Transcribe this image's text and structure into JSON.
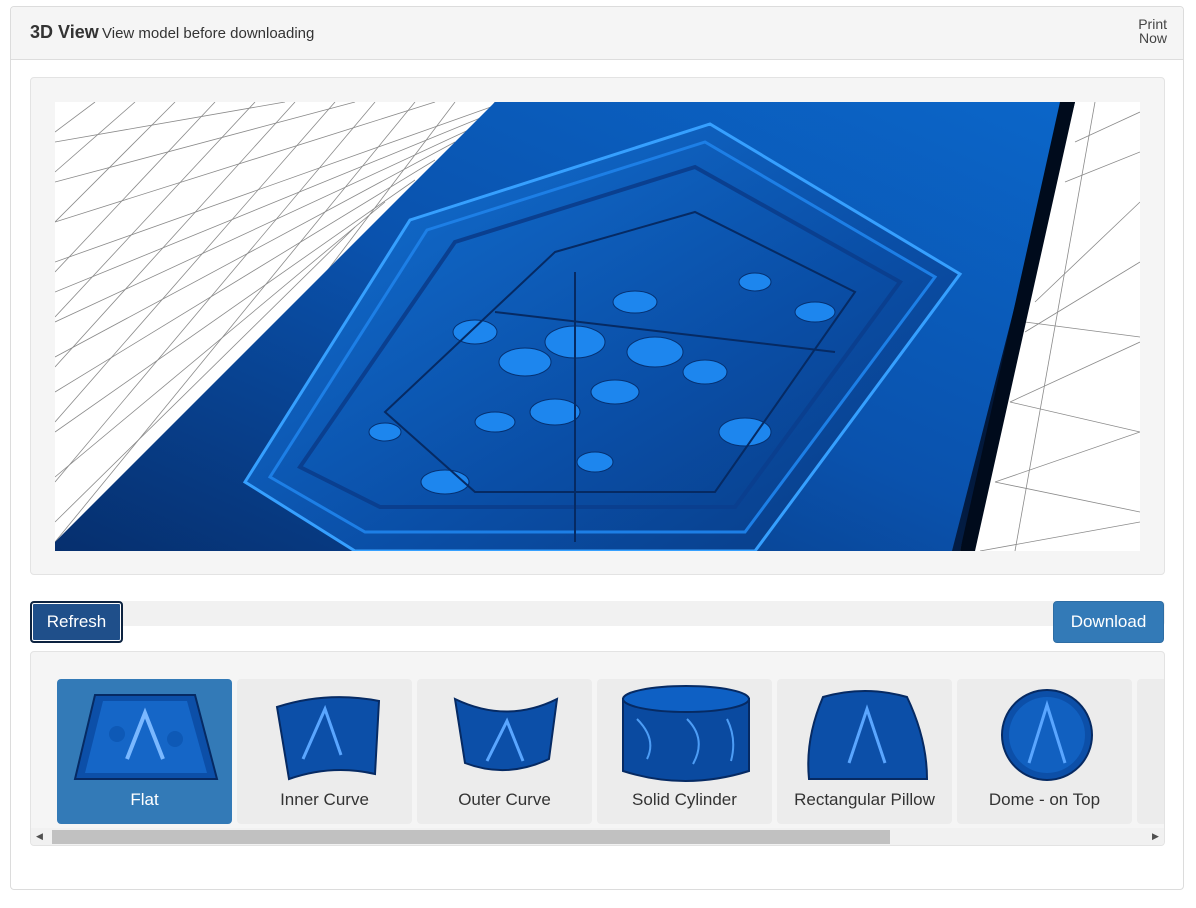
{
  "header": {
    "title": "3D View",
    "subtitle": "View model before downloading",
    "print_now": "Print Now"
  },
  "toolbar": {
    "refresh_label": "Refresh",
    "download_label": "Download"
  },
  "shapes": [
    {
      "label": "Flat",
      "active": true
    },
    {
      "label": "Inner Curve",
      "active": false
    },
    {
      "label": "Outer Curve",
      "active": false
    },
    {
      "label": "Solid Cylinder",
      "active": false
    },
    {
      "label": "Rectangular Pillow",
      "active": false
    },
    {
      "label": "Dome - on Top",
      "active": false
    }
  ],
  "colors": {
    "model_blue": "#0b55b0",
    "accent": "#337ab7",
    "refresh_bg": "#1f4f8a"
  },
  "icons": {
    "scroll_left": "triangle-left",
    "scroll_right": "triangle-right"
  }
}
